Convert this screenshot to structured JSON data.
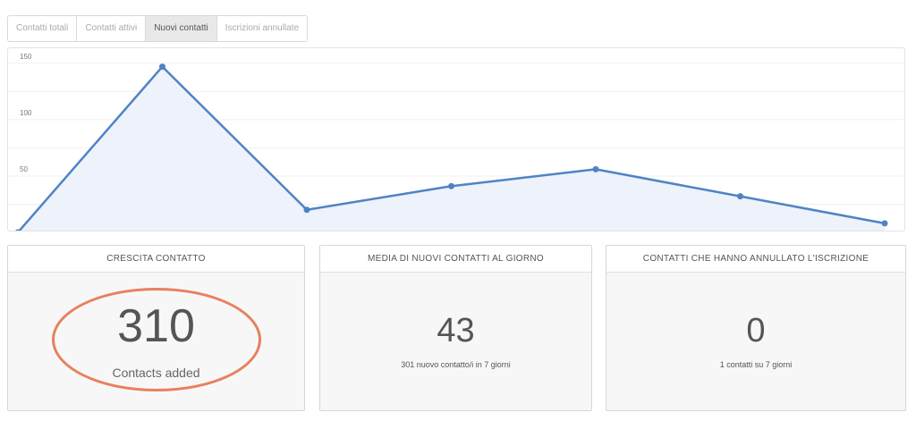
{
  "tabs": [
    {
      "label": "Contatti totali",
      "active": false
    },
    {
      "label": "Contatti attivi",
      "active": false
    },
    {
      "label": "Nuovi contatti",
      "active": true
    },
    {
      "label": "Iscrizioni annullate",
      "active": false
    }
  ],
  "colors": {
    "line": "#4f83c4",
    "area": "#edf2fb",
    "grid": "#f0f0f0",
    "highlight": "#e8805e"
  },
  "chart_data": {
    "type": "area",
    "x": [
      0,
      1,
      2,
      3,
      4,
      5,
      6
    ],
    "values": [
      0,
      147,
      20,
      41,
      56,
      32,
      8
    ],
    "yticks": [
      50,
      100,
      150
    ],
    "ylim": [
      0,
      157
    ],
    "grid": true,
    "legend": "none"
  },
  "cards": [
    {
      "title": "CRESCITA CONTATTO",
      "value": "310",
      "caption": "Contacts added"
    },
    {
      "title": "MEDIA DI NUOVI CONTATTI AL GIORNO",
      "value": "43",
      "caption": "301 nuovo contatto/i in 7 giorni"
    },
    {
      "title": "CONTATTI CHE HANNO ANNULLATO L'ISCRIZIONE",
      "value": "0",
      "caption": "1 contatti su 7 giorni"
    }
  ]
}
